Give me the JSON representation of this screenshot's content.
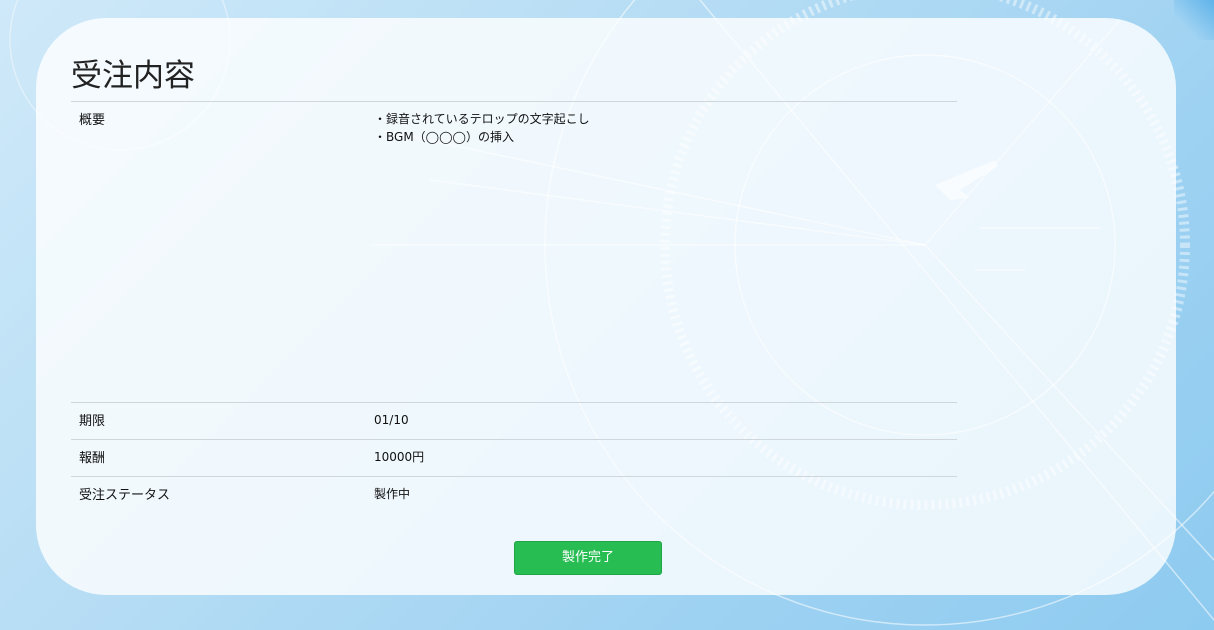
{
  "page": {
    "title": "受注内容"
  },
  "order": {
    "rows": [
      {
        "label": "概要",
        "lines": [
          "・録音されているテロップの文字起こし",
          "・BGM（◯◯◯）の挿入"
        ]
      },
      {
        "label": "期限",
        "value": "01/10"
      },
      {
        "label": "報酬",
        "value": "10000円"
      },
      {
        "label": "受注ステータス",
        "value": "製作中"
      }
    ]
  },
  "actions": {
    "complete_label": "製作完了"
  },
  "theme": {
    "button_color": "#27bd52",
    "background_color": "#b4dcf4"
  }
}
